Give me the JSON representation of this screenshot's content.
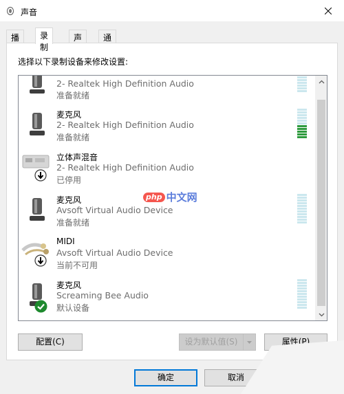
{
  "window": {
    "title": "声音",
    "close_icon": "close-icon"
  },
  "tabs": [
    {
      "label": "播放",
      "active": false
    },
    {
      "label": "录制",
      "active": true
    },
    {
      "label": "声音",
      "active": false
    },
    {
      "label": "通信",
      "active": false
    }
  ],
  "panel": {
    "instruction": "选择以下录制设备来修改设置:"
  },
  "devices": [
    {
      "name": "",
      "driver": "2- Realtek High Definition Audio",
      "status": "准备就绪",
      "icon": "microphone-icon",
      "badge": "",
      "level": 0
    },
    {
      "name": "麦克风",
      "driver": "2- Realtek High Definition Audio",
      "status": "准备就绪",
      "icon": "microphone-icon",
      "badge": "",
      "level": 0.4
    },
    {
      "name": "立体声混音",
      "driver": "2- Realtek High Definition Audio",
      "status": "已停用",
      "icon": "stereo-mix-icon",
      "badge": "disabled-arrow",
      "level": 0
    },
    {
      "name": "麦克风",
      "driver": "Avsoft Virtual Audio Device",
      "status": "准备就绪",
      "icon": "microphone-icon",
      "badge": "",
      "level": 0
    },
    {
      "name": "MIDI",
      "driver": "Avsoft Virtual Audio Device",
      "status": "当前不可用",
      "icon": "midi-cable-icon",
      "badge": "disabled-arrow",
      "level": 0
    },
    {
      "name": "麦克风",
      "driver": "Screaming Bee Audio",
      "status": "默认设备",
      "icon": "microphone-icon",
      "badge": "default-check",
      "level": 0
    }
  ],
  "buttons": {
    "configure": "配置(C)",
    "set_default": "设为默认值(S)",
    "properties": "属性(P)",
    "ok": "确定",
    "cancel": "取消"
  },
  "watermark": {
    "badge": "php",
    "text": "中文网"
  },
  "colors": {
    "meter_off": "#cbe7ee",
    "meter_on": "#2e9b3e",
    "default_check": "#1e8a2e"
  }
}
